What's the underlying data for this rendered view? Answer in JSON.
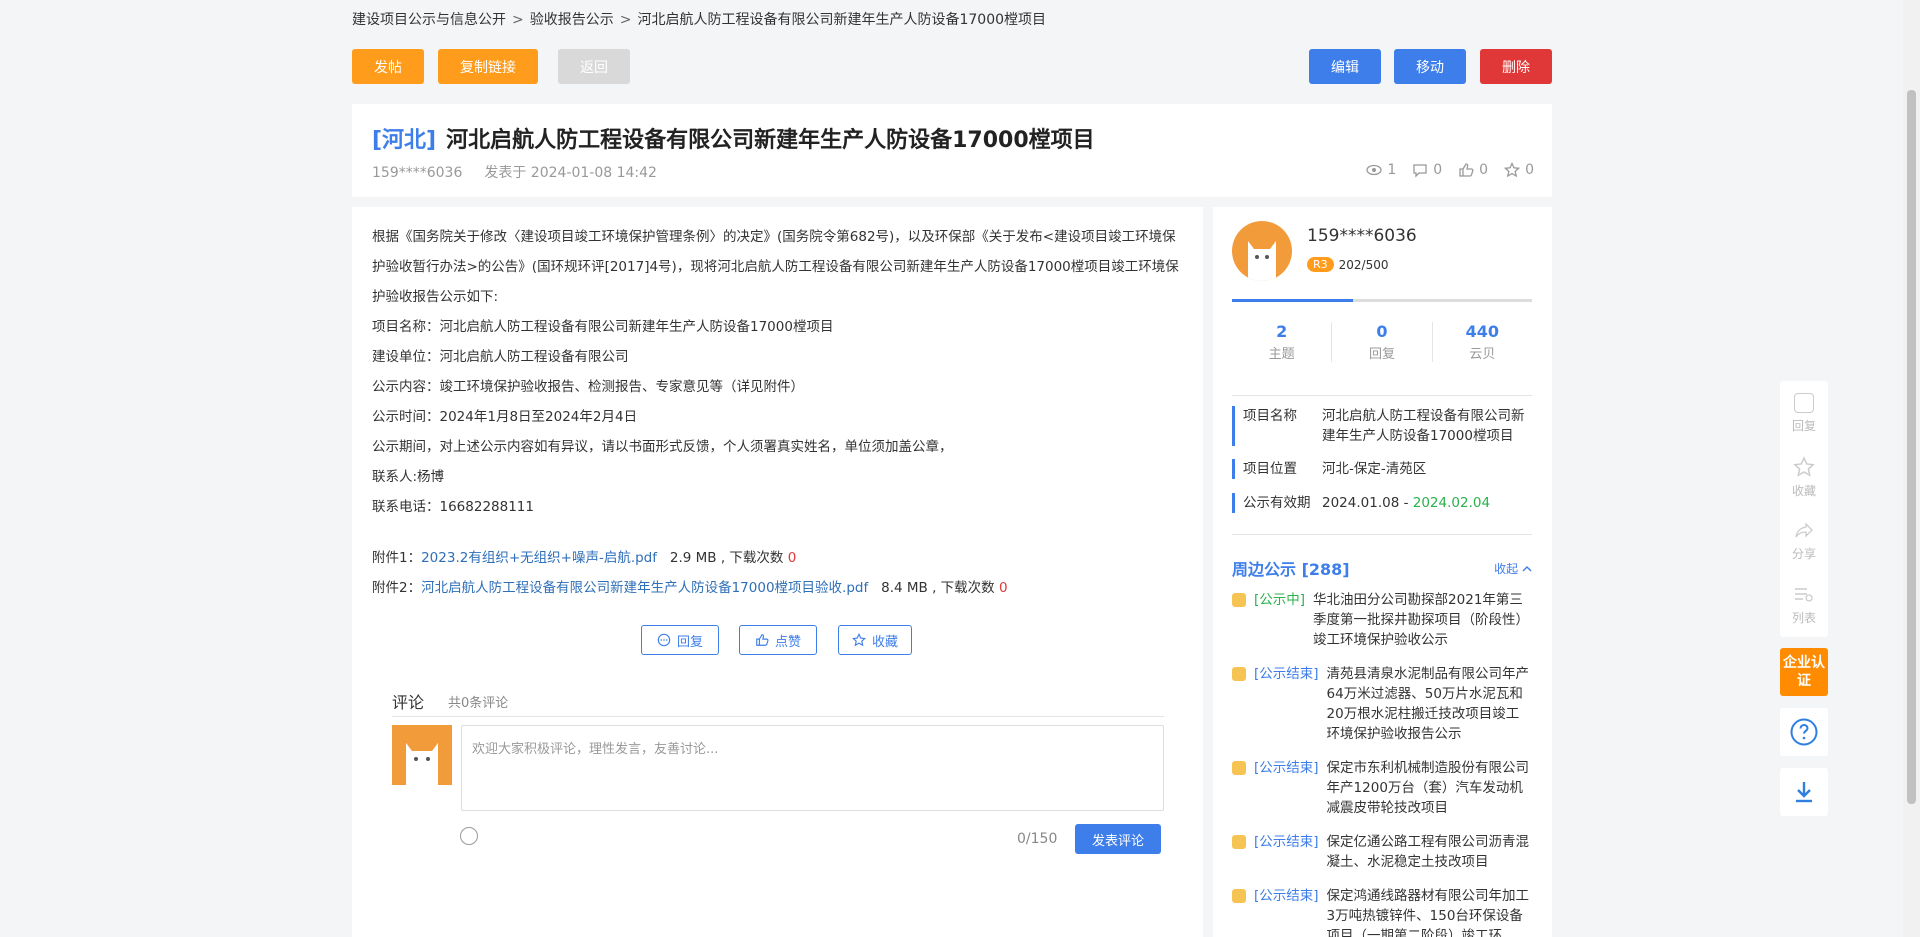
{
  "breadcrumb": [
    "建设项目公示与信息公开",
    "验收报告公示",
    "河北启航人防工程设备有限公司新建年生产人防设备17000樘项目"
  ],
  "toolbar": {
    "post": "发帖",
    "copy_link": "复制链接",
    "back": "返回",
    "edit": "编辑",
    "move": "移动",
    "delete": "删除"
  },
  "post": {
    "region": "[河北]",
    "title": "河北启航人防工程设备有限公司新建年生产人防设备17000樘项目",
    "author": "159****6036",
    "posted": "发表于 2024-01-08 14:42",
    "views": "1",
    "comments": "0",
    "likes": "0",
    "favorites": "0"
  },
  "content": {
    "paragraphs": [
      "根据《国务院关于修改〈建设项目竣工环境保护管理条例〉的决定》(国务院令第682号)，以及环保部《关于发布<建设项目竣工环境保护验收暂行办法>的公告》(国环规环评[2017]4号)，现将河北启航人防工程设备有限公司新建年生产人防设备17000樘项目竣工环境保护验收报告公示如下:",
      "项目名称：河北启航人防工程设备有限公司新建年生产人防设备17000樘项目",
      "建设单位：河北启航人防工程设备有限公司",
      "公示内容：竣工环境保护验收报告、检测报告、专家意见等（详见附件）",
      "公示时间：2024年1月8日至2024年2月4日",
      "公示期间，对上述公示内容如有异议，请以书面形式反馈，个人须署真实姓名，单位须加盖公章，",
      "联系人:杨博",
      "联系电话：16682288111"
    ],
    "attachments": [
      {
        "label": "附件1：",
        "name": "2023.2有组织+无组织+噪声-启航.pdf",
        "size": "2.9 MB , 下载次数",
        "downloads": "0"
      },
      {
        "label": "附件2：",
        "name": "河北启航人防工程设备有限公司新建年生产人防设备17000樘项目验收.pdf",
        "size": "8.4 MB , 下载次数",
        "downloads": "0"
      }
    ],
    "actions": {
      "reply": "回复",
      "like": "点赞",
      "favorite": "收藏"
    }
  },
  "comments": {
    "tab": "评论",
    "count": "共0条评论",
    "placeholder": "欢迎大家积极评论，理性发言，友善讨论...",
    "char_count": "0/150",
    "submit": "发表评论"
  },
  "user": {
    "name": "159****6036",
    "level": "R3",
    "progress_text": "202/500",
    "progress_fraction": 0.404,
    "topics": "2",
    "topics_label": "主题",
    "replies": "0",
    "replies_label": "回复",
    "shells": "440",
    "shells_label": "云贝"
  },
  "project_info": {
    "name_key": "项目名称",
    "name_val": "河北启航人防工程设备有限公司新建年生产人防设备17000樘项目",
    "location_key": "项目位置",
    "location_val": "河北-保定-清苑区",
    "period_key": "公示有效期",
    "period_start": "2024.01.08 - ",
    "period_end": "2024.02.04"
  },
  "nearby": {
    "title": "周边公示 [288]",
    "collapse": "收起",
    "items": [
      {
        "status": "[公示中]",
        "text": "华北油田分公司勘探部2021年第三季度第一批探井勘探项目（阶段性）竣工环境保护验收公示"
      },
      {
        "status": "[公示结束]",
        "text": "清苑县清泉水泥制品有限公司年产64万米过滤器、50万片水泥瓦和20万根水泥柱搬迁技改项目竣工环境保护验收报告公示"
      },
      {
        "status": "[公示结束]",
        "text": "保定市东利机械制造股份有限公司年产1200万台（套）汽车发动机减震皮带轮技改项目"
      },
      {
        "status": "[公示结束]",
        "text": "保定亿通公路工程有限公司沥青混凝土、水泥稳定土技改项目"
      },
      {
        "status": "[公示结束]",
        "text": "保定鸿通线路器材有限公司年加工3万吨热镀锌件、150台环保设备项目（一期第二阶段）竣工环"
      }
    ]
  },
  "floating": {
    "reply": "回复",
    "favorite": "收藏",
    "share": "分享",
    "list": "列表",
    "enterprise": "企业认证"
  },
  "colors": {
    "accent": "#3d7eea",
    "orange": "#ff9c1b",
    "red": "#e03838",
    "green": "#2bb24c"
  }
}
